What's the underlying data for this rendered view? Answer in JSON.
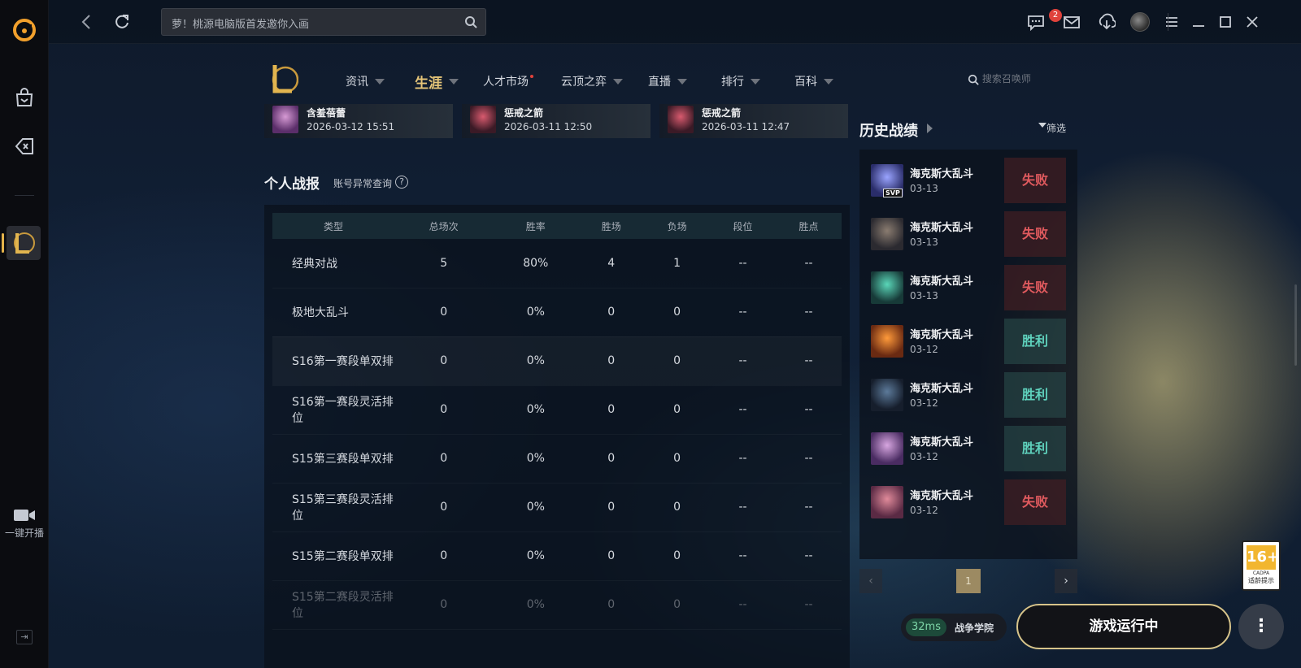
{
  "topbar": {
    "search_placeholder": "萝！桃源电脑版首发邀你入画",
    "mail_badge": "2"
  },
  "rail": {
    "broadcast_label": "一键开播"
  },
  "nav": {
    "items": [
      {
        "label": "资讯"
      },
      {
        "label": "生涯"
      },
      {
        "label": "人才市场"
      },
      {
        "label": "云顶之弈"
      },
      {
        "label": "直播"
      },
      {
        "label": "排行"
      },
      {
        "label": "百科"
      }
    ],
    "search_placeholder": "搜索召唤师"
  },
  "recent": [
    {
      "name": "含羞蓓蕾",
      "time": "2026-03-12 15:51"
    },
    {
      "name": "惩戒之箭",
      "time": "2026-03-11 12:50"
    },
    {
      "name": "惩戒之箭",
      "time": "2026-03-11 12:47"
    }
  ],
  "report": {
    "title": "个人战报",
    "link": "账号异常查询",
    "help": "?",
    "headers": [
      "类型",
      "总场次",
      "胜率",
      "胜场",
      "负场",
      "段位",
      "胜点"
    ],
    "rows": [
      [
        "经典对战",
        "5",
        "80%",
        "4",
        "1",
        "--",
        "--"
      ],
      [
        "极地大乱斗",
        "0",
        "0%",
        "0",
        "0",
        "--",
        "--"
      ],
      [
        "S16第一赛段单双排",
        "0",
        "0%",
        "0",
        "0",
        "--",
        "--"
      ],
      [
        "S16第一赛段灵活排位",
        "0",
        "0%",
        "0",
        "0",
        "--",
        "--"
      ],
      [
        "S15第三赛段单双排",
        "0",
        "0%",
        "0",
        "0",
        "--",
        "--"
      ],
      [
        "S15第三赛段灵活排位",
        "0",
        "0%",
        "0",
        "0",
        "--",
        "--"
      ],
      [
        "S15第二赛段单双排",
        "0",
        "0%",
        "0",
        "0",
        "--",
        "--"
      ],
      [
        "S15第二赛段灵活排位",
        "0",
        "0%",
        "0",
        "0",
        "--",
        "--"
      ]
    ]
  },
  "history": {
    "title": "历史战绩",
    "filter": "筛选",
    "svp": "SVP",
    "matches": [
      {
        "mode": "海克斯大乱斗",
        "date": "03-13",
        "result": "失败"
      },
      {
        "mode": "海克斯大乱斗",
        "date": "03-13",
        "result": "失败"
      },
      {
        "mode": "海克斯大乱斗",
        "date": "03-13",
        "result": "失败"
      },
      {
        "mode": "海克斯大乱斗",
        "date": "03-12",
        "result": "胜利"
      },
      {
        "mode": "海克斯大乱斗",
        "date": "03-12",
        "result": "胜利"
      },
      {
        "mode": "海克斯大乱斗",
        "date": "03-12",
        "result": "胜利"
      },
      {
        "mode": "海克斯大乱斗",
        "date": "03-12",
        "result": "失败"
      }
    ],
    "page": "1"
  },
  "age_rating": {
    "number": "16+",
    "org": "CADPA",
    "note": "适龄提示"
  },
  "status": {
    "ping": "32ms",
    "server": "战争学院",
    "run_button": "游戏运行中",
    "more": "⋮"
  },
  "colors": {
    "accent": "#e7c679",
    "win": "#5fd2bd",
    "lose": "#e05a5e"
  }
}
